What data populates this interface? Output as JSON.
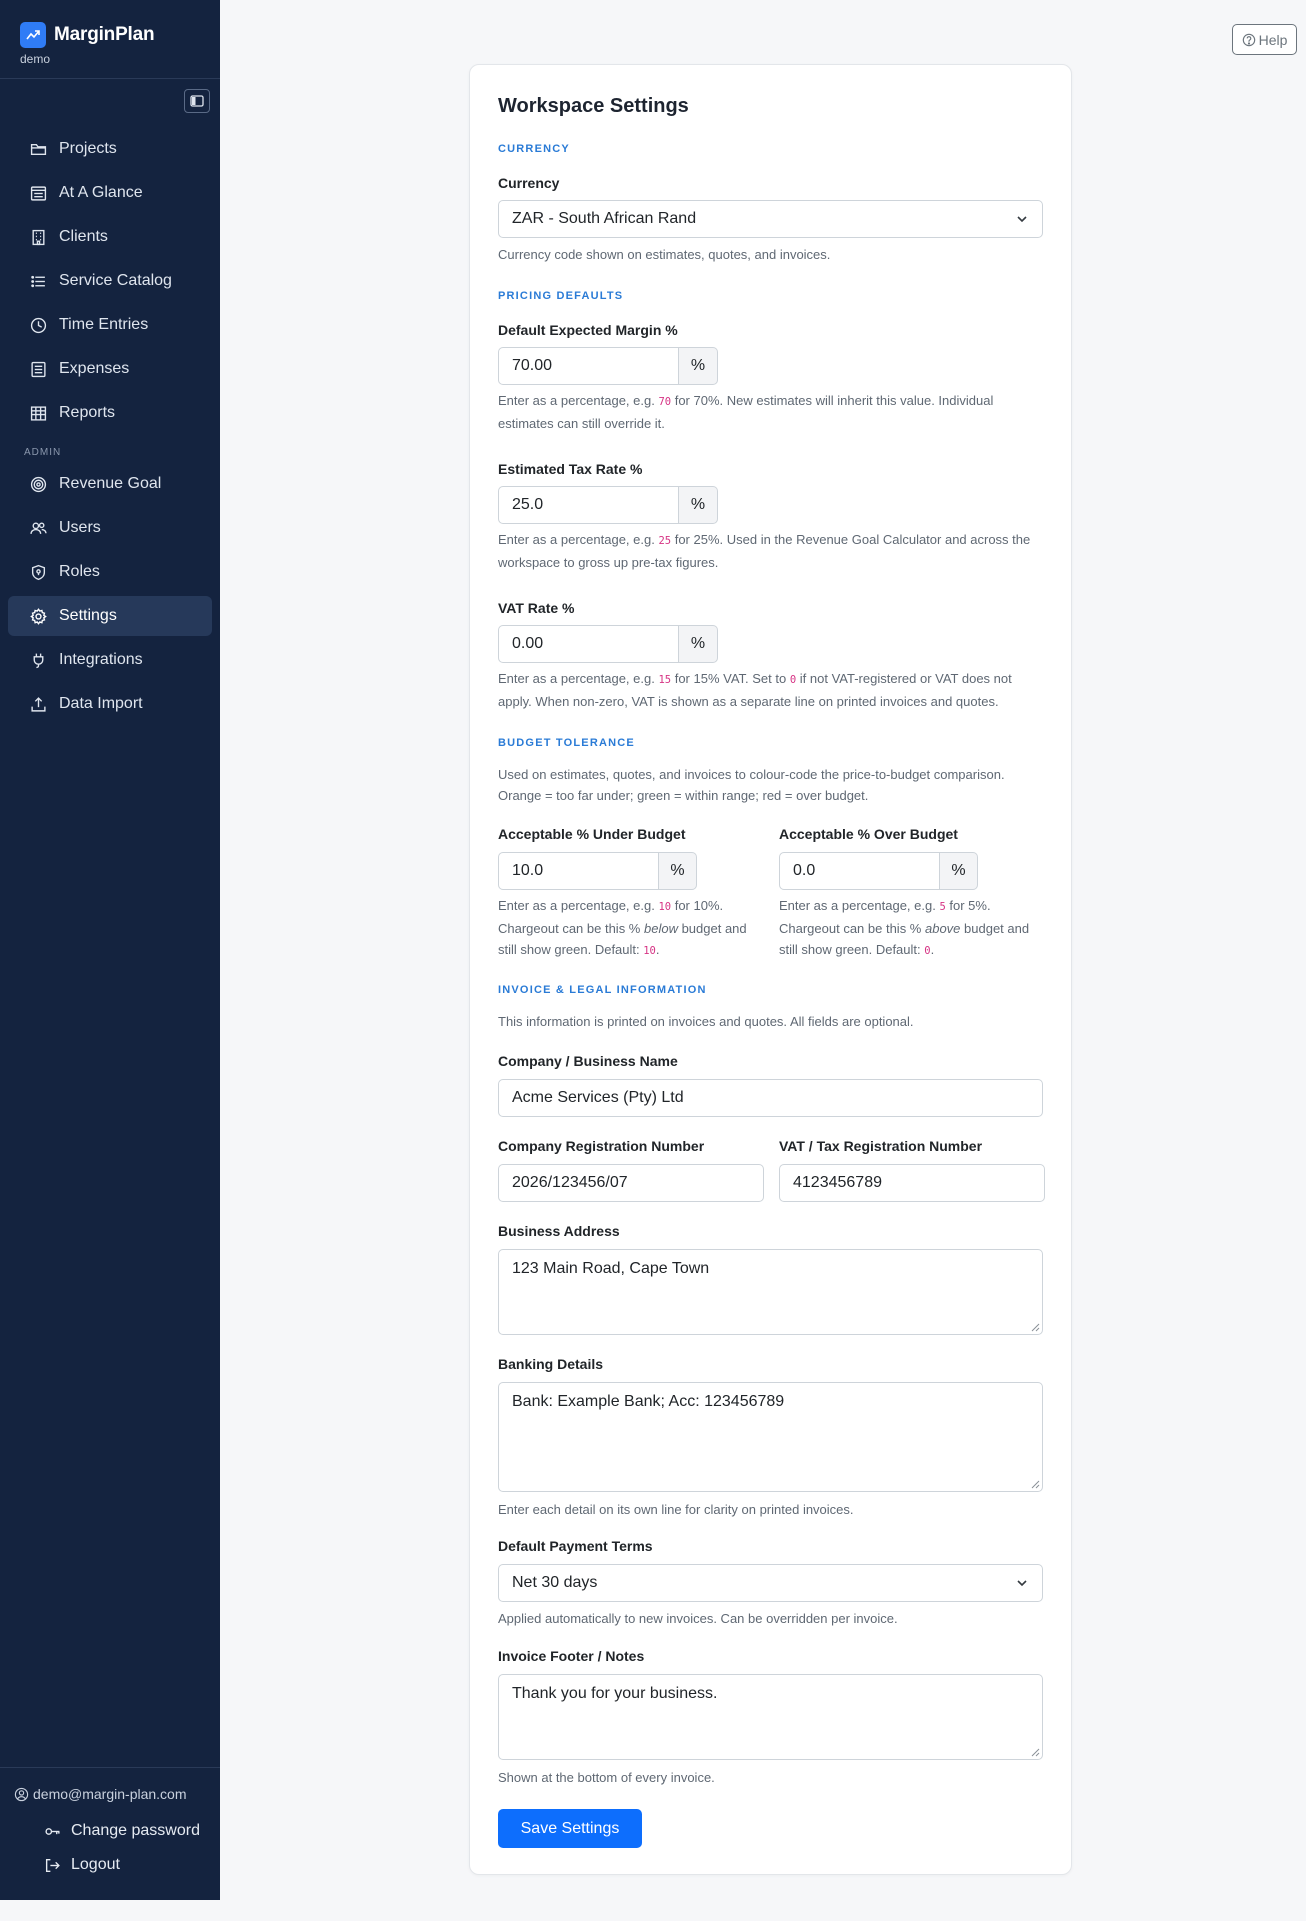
{
  "app": {
    "name": "MarginPlan",
    "workspace": "demo"
  },
  "sidebar": {
    "items": [
      {
        "label": "Projects"
      },
      {
        "label": "At A Glance"
      },
      {
        "label": "Clients"
      },
      {
        "label": "Service Catalog"
      },
      {
        "label": "Time Entries"
      },
      {
        "label": "Expenses"
      },
      {
        "label": "Reports"
      }
    ],
    "admin_label": "ADMIN",
    "admin_items": [
      {
        "label": "Revenue Goal"
      },
      {
        "label": "Users"
      },
      {
        "label": "Roles"
      },
      {
        "label": "Settings",
        "active": true
      },
      {
        "label": "Integrations"
      },
      {
        "label": "Data Import"
      }
    ],
    "user_email": "demo@margin-plan.com",
    "change_password": "Change password",
    "logout": "Logout"
  },
  "header": {
    "help_label": "Help"
  },
  "settings": {
    "title": "Workspace Settings",
    "currency_section": "CURRENCY",
    "currency_label": "Currency",
    "currency_value": "ZAR - South African Rand",
    "currency_help": "Currency code shown on estimates, quotes, and invoices.",
    "pricing_section": "PRICING DEFAULTS",
    "margin_label": "Default Expected Margin %",
    "margin_value": "70.00",
    "margin_help_a": "Enter as a percentage, e.g. ",
    "margin_help_code": "70",
    "margin_help_b": " for 70%. New estimates will inherit this value. Individual estimates can still override it.",
    "tax_label": "Estimated Tax Rate %",
    "tax_value": "25.0",
    "tax_help_a": "Enter as a percentage, e.g. ",
    "tax_help_code": "25",
    "tax_help_b": " for 25%. Used in the Revenue Goal Calculator and across the workspace to gross up pre-tax figures.",
    "vat_label": "VAT Rate %",
    "vat_value": "0.00",
    "vat_help_a": "Enter as a percentage, e.g. ",
    "vat_help_code1": "15",
    "vat_help_b": " for 15% VAT. Set to ",
    "vat_help_code2": "0",
    "vat_help_c": " if not VAT-registered or VAT does not apply. When non-zero, VAT is shown as a separate line on printed invoices and quotes.",
    "percent": "%",
    "budget_section": "BUDGET TOLERANCE",
    "budget_intro": "Used on estimates, quotes, and invoices to colour-code the price-to-budget comparison. Orange = too far under; green = within range; red = over budget.",
    "under_label": "Acceptable % Under Budget",
    "under_value": "10.0",
    "under_help_a": "Enter as a percentage, e.g. ",
    "under_help_code": "10",
    "under_help_b": " for 10%. Chargeout can be this % ",
    "under_help_em": "below",
    "under_help_c": " budget and still show green. Default: ",
    "under_help_default": "10",
    "over_label": "Acceptable % Over Budget",
    "over_value": "0.0",
    "over_help_a": "Enter as a percentage, e.g. ",
    "over_help_code": "5",
    "over_help_b": " for 5%. Chargeout can be this % ",
    "over_help_em": "above",
    "over_help_c": " budget and still show green. Default: ",
    "over_help_default": "0",
    "period": ".",
    "invoice_section": "INVOICE & LEGAL INFORMATION",
    "invoice_intro": "This information is printed on invoices and quotes. All fields are optional.",
    "company_label": "Company / Business Name",
    "company_value": "Acme Services (Pty) Ltd",
    "reg_label": "Company Registration Number",
    "reg_value": "2026/123456/07",
    "vatreg_label": "VAT / Tax Registration Number",
    "vatreg_value": "4123456789",
    "address_label": "Business Address",
    "address_value": "123 Main Road, Cape Town",
    "banking_label": "Banking Details",
    "banking_value": "Bank: Example Bank; Acc: 123456789",
    "banking_help": "Enter each detail on its own line for clarity on printed invoices.",
    "terms_label": "Default Payment Terms",
    "terms_value": "Net 30 days",
    "terms_help": "Applied automatically to new invoices. Can be overridden per invoice.",
    "footer_label": "Invoice Footer / Notes",
    "footer_value": "Thank you for your business.",
    "footer_help": "Shown at the bottom of every invoice.",
    "save_label": "Save Settings"
  }
}
